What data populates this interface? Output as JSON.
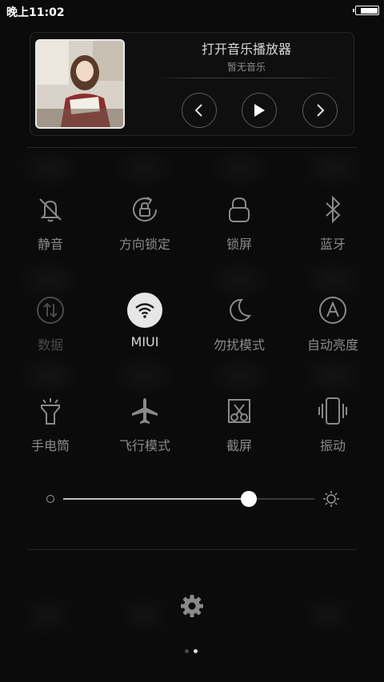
{
  "status_bar": {
    "time": "晚上11:02",
    "battery_level": 0.85
  },
  "music": {
    "title": "打开音乐播放器",
    "subtitle": "暂无音乐",
    "album_art_icon": "album-art-photo",
    "controls": {
      "prev_icon": "chevron-left-icon",
      "play_icon": "play-icon",
      "next_icon": "chevron-right-icon"
    }
  },
  "toggles": [
    {
      "label": "静音",
      "icon": "bell-off-icon",
      "state": "off"
    },
    {
      "label": "方向锁定",
      "icon": "rotation-lock-icon",
      "state": "off"
    },
    {
      "label": "锁屏",
      "icon": "lock-icon",
      "state": "off"
    },
    {
      "label": "蓝牙",
      "icon": "bluetooth-icon",
      "state": "off"
    },
    {
      "label": "数据",
      "icon": "mobile-data-icon",
      "state": "disabled"
    },
    {
      "label": "MIUI",
      "icon": "wifi-icon",
      "state": "on"
    },
    {
      "label": "勿扰模式",
      "icon": "moon-icon",
      "state": "off"
    },
    {
      "label": "自动亮度",
      "icon": "auto-brightness-icon",
      "state": "off"
    },
    {
      "label": "手电筒",
      "icon": "flashlight-icon",
      "state": "off"
    },
    {
      "label": "飞行模式",
      "icon": "airplane-icon",
      "state": "off"
    },
    {
      "label": "截屏",
      "icon": "screenshot-icon",
      "state": "off"
    },
    {
      "label": "振动",
      "icon": "vibrate-icon",
      "state": "off"
    }
  ],
  "brightness": {
    "level": 0.74,
    "min_icon": "brightness-low-icon",
    "max_icon": "brightness-high-icon"
  },
  "settings_icon": "gear-icon",
  "pager": {
    "pages": 2,
    "current": 2
  },
  "colors": {
    "background": "#0b0b0b",
    "active_toggle": "#e6e6e6",
    "label": "#8a8a8a"
  }
}
